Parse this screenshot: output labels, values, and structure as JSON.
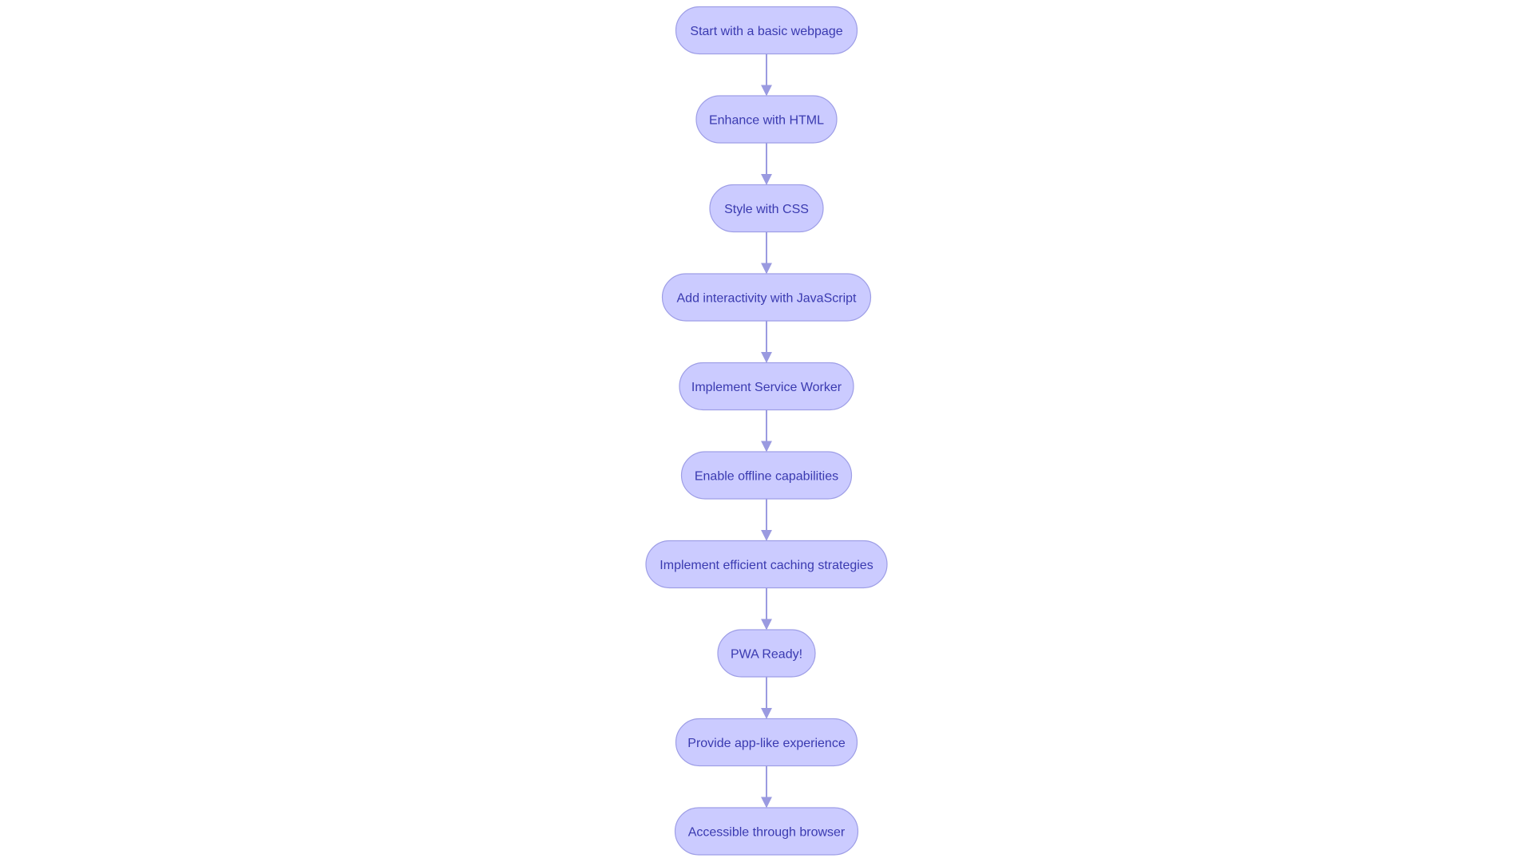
{
  "diagram": {
    "type": "flowchart",
    "direction": "top-to-bottom",
    "colors": {
      "node_fill": "#cbcbff",
      "node_stroke": "#9e9ee6",
      "text": "#3a3ab0",
      "edge": "#9a9ae0"
    },
    "nodes": [
      {
        "id": "n1",
        "label": "Start with a basic webpage"
      },
      {
        "id": "n2",
        "label": "Enhance with HTML"
      },
      {
        "id": "n3",
        "label": "Style with CSS"
      },
      {
        "id": "n4",
        "label": "Add interactivity with JavaScript"
      },
      {
        "id": "n5",
        "label": "Implement Service Worker"
      },
      {
        "id": "n6",
        "label": "Enable offline capabilities"
      },
      {
        "id": "n7",
        "label": "Implement efficient caching strategies"
      },
      {
        "id": "n8",
        "label": "PWA Ready!"
      },
      {
        "id": "n9",
        "label": "Provide app-like experience"
      },
      {
        "id": "n10",
        "label": "Accessible through browser"
      }
    ],
    "edges": [
      [
        "n1",
        "n2"
      ],
      [
        "n2",
        "n3"
      ],
      [
        "n3",
        "n4"
      ],
      [
        "n4",
        "n5"
      ],
      [
        "n5",
        "n6"
      ],
      [
        "n6",
        "n7"
      ],
      [
        "n7",
        "n8"
      ],
      [
        "n8",
        "n9"
      ],
      [
        "n9",
        "n10"
      ]
    ]
  }
}
